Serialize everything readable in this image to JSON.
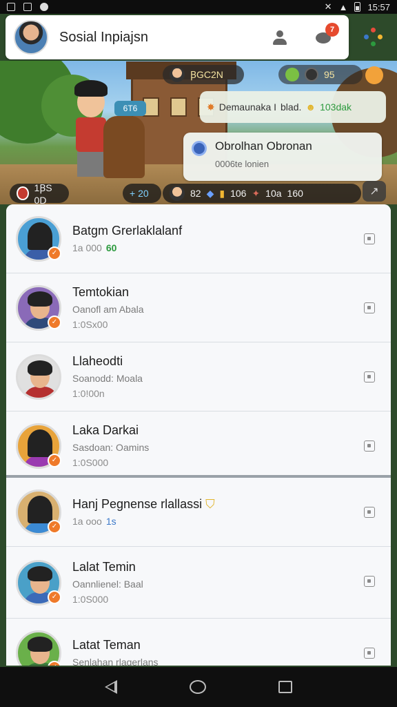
{
  "status_bar": {
    "time": "15:57"
  },
  "header": {
    "title": "Sosial Inpiajsn",
    "chat_badge": "7"
  },
  "banner": {
    "top_pill_left": "ꞴGC2N",
    "top_pill_right": "95",
    "tag": "6T6",
    "notification": {
      "text": "Demaunaka I",
      "highlight": "blad.",
      "value": "103dak"
    },
    "popup": {
      "title": "Obrolhan Obronan",
      "subtitle": "0006te lonien"
    },
    "bottom_left": "1ꞴS 0D",
    "bottom_items": [
      "+ 20",
      "82",
      "106",
      "10a",
      "160"
    ]
  },
  "friends": [
    {
      "name": "Batgm Grerlaklalanf",
      "subtitle": "",
      "meta": "1a 000",
      "meta_highlight": "60",
      "highlight_color": "green"
    },
    {
      "name": "Temtokian",
      "subtitle": "Oanofl am Abala",
      "meta": "1:0Sx00",
      "meta_highlight": "",
      "highlight_color": ""
    },
    {
      "name": "Llaheodti",
      "subtitle": "Soanodd: Moala",
      "meta": "1:0!00n",
      "meta_highlight": "",
      "highlight_color": ""
    },
    {
      "name": "Laka Darkai",
      "subtitle": "Sasdoan: Oamins",
      "meta": "1:0S000",
      "meta_highlight": "",
      "highlight_color": ""
    },
    {
      "name": "Hanj Pegnense rlallassi",
      "subtitle": "",
      "meta": "1a ooo",
      "meta_highlight": "1s",
      "highlight_color": "blue"
    },
    {
      "name": "Lalat Temin",
      "subtitle": "Oannlienel: Baal",
      "meta": "1:0S000",
      "meta_highlight": "",
      "highlight_color": ""
    },
    {
      "name": "Latat Teman",
      "subtitle": "Senlahan rlagerlans",
      "meta": "",
      "meta_highlight": "",
      "highlight_color": ""
    }
  ]
}
